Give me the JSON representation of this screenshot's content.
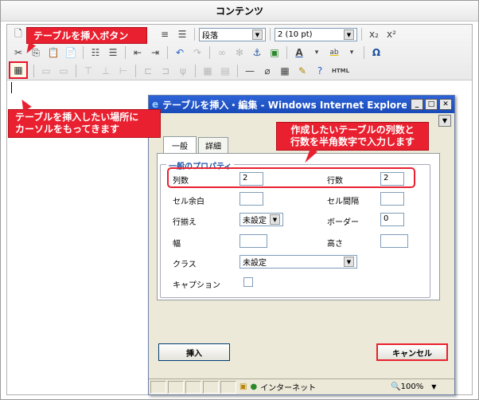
{
  "header": {
    "title": "コンテンツ"
  },
  "toolbar": {
    "format_select": "段落",
    "size_select": "2 (10 pt)",
    "html_label": "HTML"
  },
  "callouts": {
    "table_button": "テーブルを挿入ボタン",
    "cursor_line1": "テーブルを挿入したい場所に",
    "cursor_line2": "カーソルをもってきます",
    "dialog_line1": "作成したいテーブルの列数と",
    "dialog_line2": "行数を半角数字で入力します"
  },
  "dialog": {
    "title": "テーブルを挿入・編集 - Windows Internet Explorer",
    "tabs": [
      "一般",
      "詳細"
    ],
    "legend": "一般のプロパティ",
    "fields": {
      "cols_label": "列数",
      "cols_value": "2",
      "rows_label": "行数",
      "rows_value": "2",
      "cellpadding_label": "セル余白",
      "cellspacing_label": "セル間隔",
      "align_label": "行揃え",
      "align_value": "未設定",
      "border_label": "ボーダー",
      "border_value": "0",
      "width_label": "幅",
      "height_label": "高さ",
      "class_label": "クラス",
      "class_value": "未設定",
      "caption_label": "キャプション"
    },
    "insert_button": "挿入",
    "cancel_button": "キャンセル",
    "status_zone": "インターネット",
    "zoom": "100%"
  },
  "colors": {
    "accent": "#e9202f",
    "title_bar": "#1949b8"
  }
}
